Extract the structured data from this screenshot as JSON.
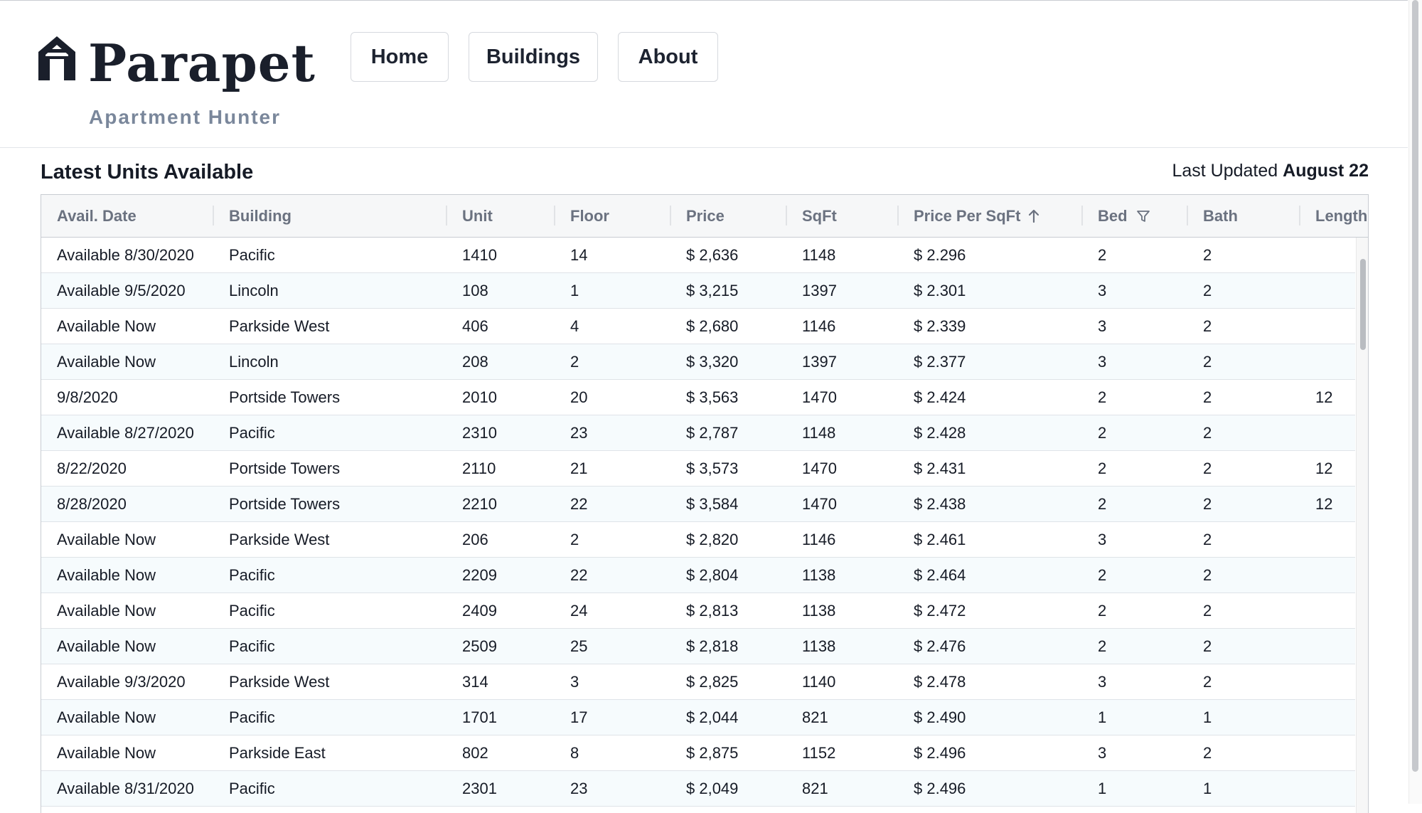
{
  "header": {
    "brand": "Parapet",
    "tagline": "Apartment Hunter",
    "logo_icon": "house-logo-icon",
    "nav": [
      "Home",
      "Buildings",
      "About"
    ]
  },
  "main": {
    "title": "Latest Units Available",
    "updated_label": "Last Updated",
    "updated_value": "August 22"
  },
  "table": {
    "columns": [
      "Avail. Date",
      "Building",
      "Unit",
      "Floor",
      "Price",
      "SqFt",
      "Price Per SqFt",
      "Bed",
      "Bath",
      "Length"
    ],
    "sort": {
      "column": "Price Per SqFt",
      "direction": "ascending",
      "icon": "arrow-up-icon"
    },
    "filter": {
      "column": "Bed",
      "icon": "filter-icon"
    },
    "rows": [
      [
        "Available 8/30/2020",
        "Pacific",
        "1410",
        "14",
        "$ 2,636",
        "1148",
        "$ 2.296",
        "2",
        "2",
        ""
      ],
      [
        "Available 9/5/2020",
        "Lincoln",
        "108",
        "1",
        "$ 3,215",
        "1397",
        "$ 2.301",
        "3",
        "2",
        ""
      ],
      [
        "Available Now",
        "Parkside West",
        "406",
        "4",
        "$ 2,680",
        "1146",
        "$ 2.339",
        "3",
        "2",
        ""
      ],
      [
        "Available Now",
        "Lincoln",
        "208",
        "2",
        "$ 3,320",
        "1397",
        "$ 2.377",
        "3",
        "2",
        ""
      ],
      [
        "9/8/2020",
        "Portside Towers",
        "2010",
        "20",
        "$ 3,563",
        "1470",
        "$ 2.424",
        "2",
        "2",
        "12"
      ],
      [
        "Available 8/27/2020",
        "Pacific",
        "2310",
        "23",
        "$ 2,787",
        "1148",
        "$ 2.428",
        "2",
        "2",
        ""
      ],
      [
        "8/22/2020",
        "Portside Towers",
        "2110",
        "21",
        "$ 3,573",
        "1470",
        "$ 2.431",
        "2",
        "2",
        "12"
      ],
      [
        "8/28/2020",
        "Portside Towers",
        "2210",
        "22",
        "$ 3,584",
        "1470",
        "$ 2.438",
        "2",
        "2",
        "12"
      ],
      [
        "Available Now",
        "Parkside West",
        "206",
        "2",
        "$ 2,820",
        "1146",
        "$ 2.461",
        "3",
        "2",
        ""
      ],
      [
        "Available Now",
        "Pacific",
        "2209",
        "22",
        "$ 2,804",
        "1138",
        "$ 2.464",
        "2",
        "2",
        ""
      ],
      [
        "Available Now",
        "Pacific",
        "2409",
        "24",
        "$ 2,813",
        "1138",
        "$ 2.472",
        "2",
        "2",
        ""
      ],
      [
        "Available Now",
        "Pacific",
        "2509",
        "25",
        "$ 2,818",
        "1138",
        "$ 2.476",
        "2",
        "2",
        ""
      ],
      [
        "Available 9/3/2020",
        "Parkside West",
        "314",
        "3",
        "$ 2,825",
        "1140",
        "$ 2.478",
        "3",
        "2",
        ""
      ],
      [
        "Available Now",
        "Pacific",
        "1701",
        "17",
        "$ 2,044",
        "821",
        "$ 2.490",
        "1",
        "1",
        ""
      ],
      [
        "Available Now",
        "Parkside East",
        "802",
        "8",
        "$ 2,875",
        "1152",
        "$ 2.496",
        "3",
        "2",
        ""
      ],
      [
        "Available 8/31/2020",
        "Pacific",
        "2301",
        "23",
        "$ 2,049",
        "821",
        "$ 2.496",
        "1",
        "1",
        ""
      ]
    ]
  }
}
